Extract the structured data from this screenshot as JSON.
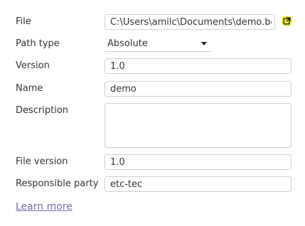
{
  "form": {
    "file": {
      "label": "File",
      "value": "C:\\Users\\amilc\\Documents\\demo.bdi",
      "open_icon": "external-link-icon",
      "open_icon_color": "#f3ee23"
    },
    "path_type": {
      "label": "Path type",
      "selected": "Absolute"
    },
    "version": {
      "label": "Version",
      "value": "1.0"
    },
    "name": {
      "label": "Name",
      "value": "demo"
    },
    "description": {
      "label": "Description",
      "value": ""
    },
    "file_version": {
      "label": "File version",
      "value": "1.0"
    },
    "responsible_party": {
      "label": "Responsible party",
      "value": "etc-tec"
    }
  },
  "links": {
    "learn_more": "Learn more",
    "link_color": "#7a6ab0"
  }
}
